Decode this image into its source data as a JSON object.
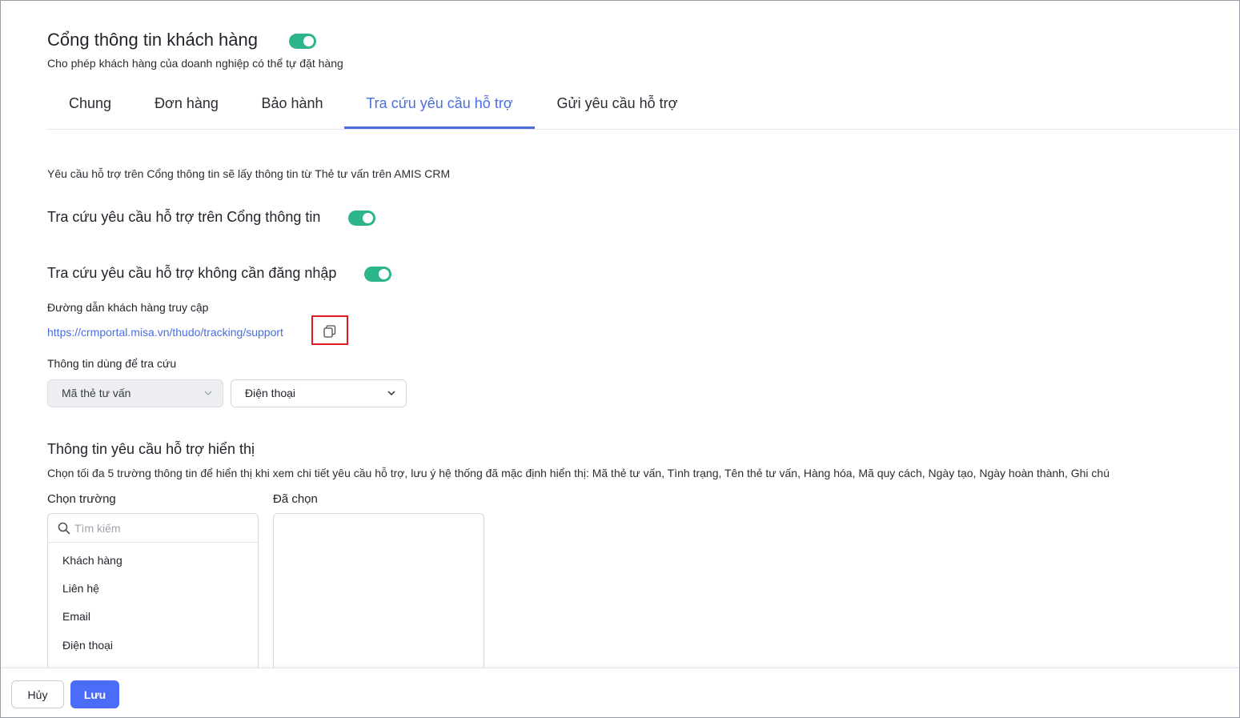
{
  "header": {
    "title": "Cổng thông tin khách hàng",
    "enabled": true,
    "subtitle": "Cho phép khách hàng của doanh nghiệp có thể tự đặt hàng"
  },
  "tabs": [
    {
      "label": "Chung",
      "active": false
    },
    {
      "label": "Đơn hàng",
      "active": false
    },
    {
      "label": "Bảo hành",
      "active": false
    },
    {
      "label": "Tra cứu yêu cầu hỗ trợ",
      "active": true
    },
    {
      "label": "Gửi yêu cầu hỗ trợ",
      "active": false
    }
  ],
  "content": {
    "description": "Yêu cầu hỗ trợ trên Cổng thông tin sẽ lấy thông tin từ Thẻ tư vấn trên AMIS CRM",
    "lookup_on_portal": {
      "label": "Tra cứu yêu cầu hỗ trợ trên Cổng thông tin",
      "enabled": true
    },
    "lookup_no_login": {
      "label": "Tra cứu yêu cầu hỗ trợ không cần đăng nhập",
      "enabled": true
    },
    "access_link_label": "Đường dẫn khách hàng truy cập",
    "access_link": "https://crmportal.misa.vn/thudo/tracking/support",
    "lookup_info_label": "Thông tin dùng để tra cứu",
    "lookup_field_1": "Mã thẻ tư vấn",
    "lookup_field_2": "Điện thoại"
  },
  "display_section": {
    "title": "Thông tin yêu cầu hỗ trợ hiển thị",
    "description": "Chọn tối đa 5 trường thông tin để hiển thị khi xem chi tiết yêu cầu hỗ trợ, lưu ý hệ thống đã mặc định hiển thị: Mã thẻ tư vấn, Tình trạng, Tên thẻ tư vấn, Hàng hóa, Mã quy cách, Ngày tạo, Ngày hoàn thành, Ghi chú",
    "choose_label": "Chọn trường",
    "selected_label": "Đã chọn",
    "search_placeholder": "Tìm kiếm",
    "fields": [
      "Khách hàng",
      "Liên hệ",
      "Email",
      "Điện thoại"
    ]
  },
  "footer": {
    "cancel_label": "Hủy",
    "save_label": "Lưu"
  },
  "colors": {
    "accent": "#4a6ee0",
    "toggle_on": "#2cb58b",
    "save_button": "#4a6cf7",
    "highlight_box": "#e01b1b"
  },
  "icons": [
    "copy-icon",
    "chevron-down-icon",
    "search-icon"
  ]
}
